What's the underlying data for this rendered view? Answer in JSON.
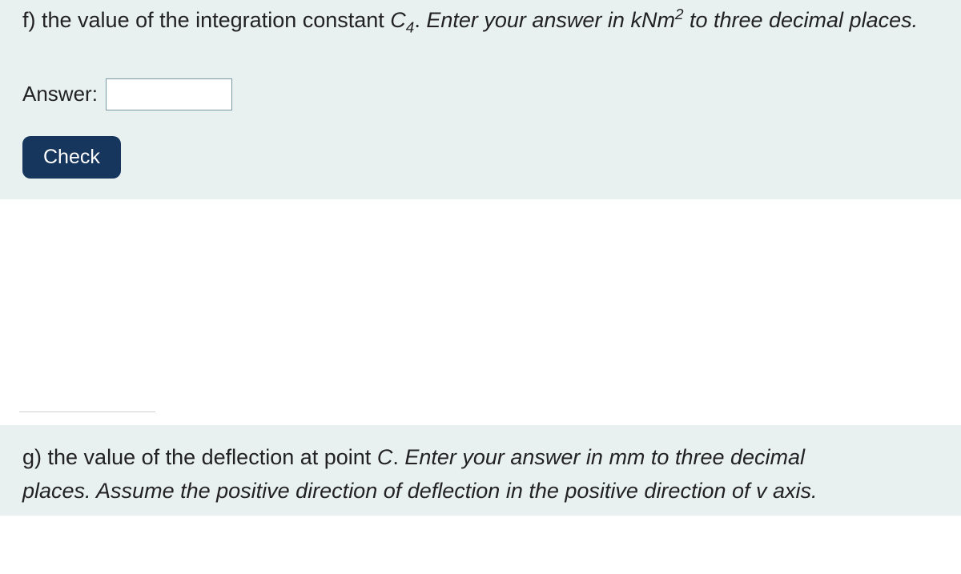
{
  "question_f": {
    "prefix": "f) ",
    "text_plain_1": "the value of the integration constant ",
    "var_C": "C",
    "sub_4": "4",
    "period": ". ",
    "instr_before_unit": "Enter your answer in kNm",
    "sup_2": "2",
    "instr_after_unit": " to three decimal places.",
    "answer_label": "Answer:",
    "check_label": "Check"
  },
  "question_g": {
    "prefix": "g) ",
    "text_plain_1": "the value of the deflection at point ",
    "var_C": "C",
    "period": ". ",
    "line1_tail": "Enter your answer in mm to three decimal ",
    "line2": "places. Assume the positive direction of deflection in the positive direction of v axis."
  }
}
